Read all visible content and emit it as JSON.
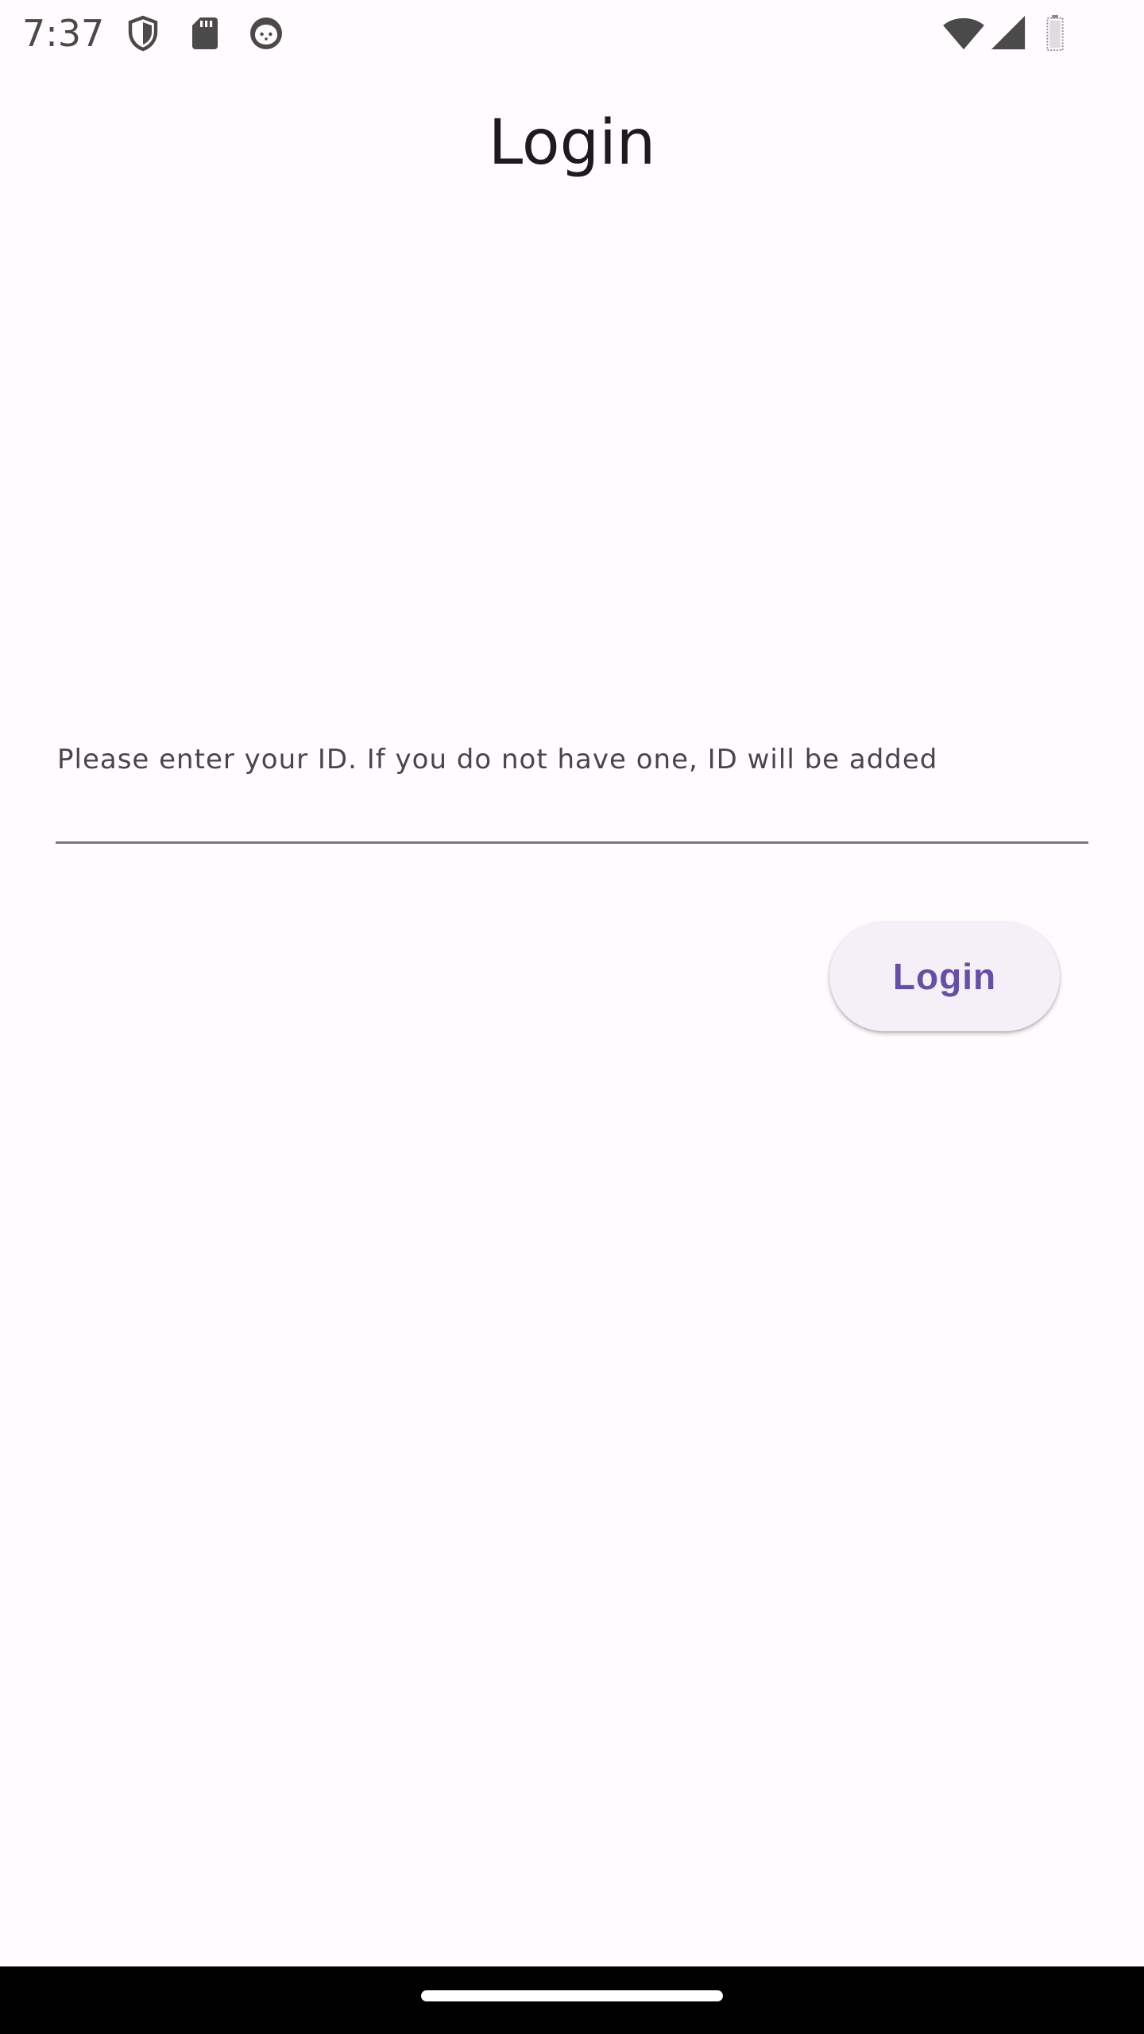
{
  "status_bar": {
    "time": "7:37",
    "left_icons": [
      "shield-icon",
      "sd-card-icon",
      "face-icon"
    ],
    "right_icons": [
      "wifi-icon",
      "signal-icon",
      "battery-icon"
    ]
  },
  "app_bar": {
    "title": "Login"
  },
  "form": {
    "id_field": {
      "label": "Please enter your ID. If you do not have one, ID will be added",
      "value": ""
    },
    "login_button_label": "Login"
  },
  "colors": {
    "background": "#fffbfe",
    "button_background": "#f5eff7",
    "button_text": "#6750a4",
    "underline": "#79747e",
    "nav_bar": "#000000"
  }
}
